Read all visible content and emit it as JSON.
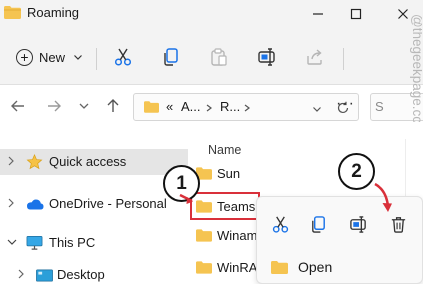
{
  "window": {
    "title": "Roaming"
  },
  "toolbar": {
    "new_label": "New"
  },
  "address": {
    "prefix": "«",
    "segment_1": "A...",
    "segment_2": "R...",
    "more": "···",
    "search_placeholder": "S"
  },
  "nav": {
    "items": [
      {
        "label": "Quick access"
      },
      {
        "label": "OneDrive - Personal"
      },
      {
        "label": "This PC"
      },
      {
        "label": "Desktop"
      }
    ]
  },
  "content": {
    "column_header": "Name",
    "files": [
      {
        "name": "Sun"
      },
      {
        "name": "Teams"
      },
      {
        "name": "Winam"
      },
      {
        "name": "WinRAF"
      }
    ]
  },
  "context_menu": {
    "open_label": "Open"
  },
  "annotations": {
    "badge_1": "1",
    "badge_2": "2"
  },
  "watermark": {
    "text": "@thegeekpage.com"
  },
  "colors": {
    "folder": "#f5c451",
    "highlight": "#d9303a",
    "selected_bg": "#e5e5e5",
    "accent_blue": "#1a73e8"
  }
}
